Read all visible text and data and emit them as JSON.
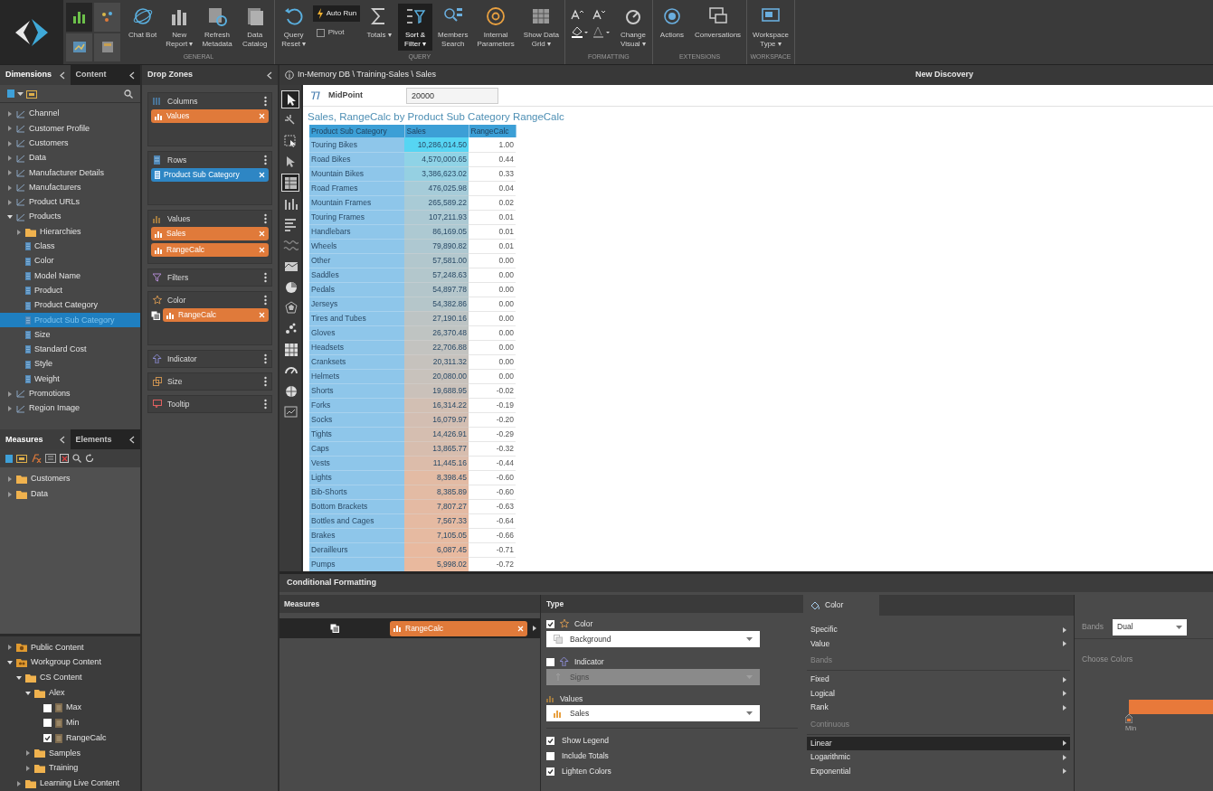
{
  "toolbar": {
    "groups": [
      {
        "label": "GENERAL",
        "buttons": [
          {
            "kind": "big",
            "lines": [
              "Chat Bot"
            ],
            "pressed": false
          },
          {
            "kind": "big",
            "lines": [
              "New",
              "Report ▾"
            ],
            "pressed": false
          },
          {
            "kind": "big",
            "lines": [
              "Refresh",
              "Metadata"
            ],
            "pressed": false
          },
          {
            "kind": "big",
            "lines": [
              "Data",
              "Catalog"
            ],
            "pressed": false
          }
        ]
      },
      {
        "label": "QUERY",
        "buttons": [
          {
            "kind": "big",
            "lines": [
              "Query",
              "Reset ▾"
            ],
            "pressed": false
          },
          {
            "kind": "stack",
            "lines": [
              "Auto Run",
              "Pivot"
            ],
            "pressed": true
          },
          {
            "kind": "big",
            "lines": [
              "Totals ▾"
            ],
            "pressed": false
          },
          {
            "kind": "big",
            "lines": [
              "Sort &",
              "Filter ▾"
            ],
            "pressed": true
          },
          {
            "kind": "big",
            "lines": [
              "Members",
              "Search"
            ],
            "pressed": false
          },
          {
            "kind": "big",
            "lines": [
              "Internal",
              "Parameters"
            ],
            "pressed": false
          },
          {
            "kind": "big",
            "lines": [
              "Show Data",
              "Grid ▾"
            ],
            "pressed": false
          }
        ]
      },
      {
        "label": "FORMATTING",
        "buttons": [
          {
            "kind": "fontgrid",
            "pressed": false
          },
          {
            "kind": "big",
            "lines": [
              "Change",
              "Visual ▾"
            ],
            "pressed": false
          }
        ]
      },
      {
        "label": "EXTENSIONS",
        "buttons": [
          {
            "kind": "big",
            "lines": [
              "Actions"
            ],
            "pressed": false
          },
          {
            "kind": "big",
            "lines": [
              "Conversations"
            ],
            "pressed": false
          }
        ]
      },
      {
        "label": "WORKSPACE",
        "buttons": [
          {
            "kind": "big",
            "lines": [
              "Workspace",
              "Type ▾"
            ],
            "pressed": false
          }
        ]
      }
    ]
  },
  "left_panel": {
    "tabs": [
      {
        "label": "Dimensions",
        "selected": true
      },
      {
        "label": "Content",
        "selected": false
      }
    ],
    "tree": [
      {
        "label": "Channel",
        "kind": "dimension",
        "expanded": false,
        "selected": false
      },
      {
        "label": "Customer Profile",
        "kind": "dimension",
        "expanded": false,
        "selected": false
      },
      {
        "label": "Customers",
        "kind": "dimension",
        "expanded": false,
        "selected": false
      },
      {
        "label": "Data",
        "kind": "dimension",
        "expanded": false,
        "selected": false
      },
      {
        "label": "Manufacturer Details",
        "kind": "dimension",
        "expanded": false,
        "selected": false
      },
      {
        "label": "Manufacturers",
        "kind": "dimension",
        "expanded": false,
        "selected": false
      },
      {
        "label": "Product URLs",
        "kind": "dimension",
        "expanded": false,
        "selected": false
      },
      {
        "label": "Products",
        "kind": "dimension",
        "expanded": true,
        "selected": false,
        "children": [
          {
            "label": "Hierarchies",
            "kind": "folder",
            "expanded": false,
            "selected": false
          },
          {
            "label": "Class",
            "kind": "attribute",
            "selected": false
          },
          {
            "label": "Color",
            "kind": "attribute",
            "selected": false
          },
          {
            "label": "Model Name",
            "kind": "attribute",
            "selected": false
          },
          {
            "label": "Product",
            "kind": "attribute",
            "selected": false
          },
          {
            "label": "Product Category",
            "kind": "attribute",
            "selected": false
          },
          {
            "label": "Product Sub Category",
            "kind": "attribute",
            "selected": true
          },
          {
            "label": "Size",
            "kind": "attribute",
            "selected": false
          },
          {
            "label": "Standard Cost",
            "kind": "attribute",
            "selected": false
          },
          {
            "label": "Style",
            "kind": "attribute",
            "selected": false
          },
          {
            "label": "Weight",
            "kind": "attribute",
            "selected": false
          }
        ]
      },
      {
        "label": "Promotions",
        "kind": "dimension",
        "expanded": false,
        "selected": false
      },
      {
        "label": "Region Image",
        "kind": "dimension",
        "expanded": false,
        "selected": false
      }
    ]
  },
  "measures_panel": {
    "tabs": [
      {
        "label": "Measures",
        "selected": true
      },
      {
        "label": "Elements",
        "selected": false
      }
    ],
    "tree": [
      {
        "label": "Customers",
        "kind": "folder",
        "expanded": false
      },
      {
        "label": "Data",
        "kind": "folder",
        "expanded": false
      }
    ]
  },
  "content_tree": [
    {
      "label": "Public Content",
      "kind": "public",
      "expanded": false
    },
    {
      "label": "Workgroup Content",
      "kind": "workgroup",
      "expanded": true,
      "children": [
        {
          "label": "CS Content",
          "kind": "folder",
          "expanded": true,
          "children": [
            {
              "label": "Alex",
              "kind": "folder",
              "expanded": true,
              "children": [
                {
                  "label": "Max",
                  "kind": "report",
                  "checked": false
                },
                {
                  "label": "Min",
                  "kind": "report",
                  "checked": false
                },
                {
                  "label": "RangeCalc",
                  "kind": "report",
                  "checked": true
                }
              ]
            },
            {
              "label": "Samples",
              "kind": "folder",
              "expanded": false
            },
            {
              "label": "Training",
              "kind": "folder",
              "expanded": false
            }
          ]
        },
        {
          "label": "Learning Live Content",
          "kind": "folder",
          "expanded": false
        }
      ]
    }
  ],
  "drop_zones": {
    "title": "Drop Zones",
    "zones": [
      {
        "label": "Columns",
        "kind": "columns",
        "expanded": true,
        "chips": [
          {
            "label": "Values",
            "color": "#e07a3a",
            "kind": "measure"
          }
        ]
      },
      {
        "label": "Rows",
        "kind": "rows",
        "expanded": true,
        "chips": [
          {
            "label": "Product Sub Category",
            "color": "#2e86c4",
            "kind": "hierarchy"
          }
        ]
      },
      {
        "label": "Values",
        "kind": "values",
        "expanded": true,
        "chips": [
          {
            "label": "Sales",
            "color": "#e07a3a",
            "kind": "measure"
          },
          {
            "label": "RangeCalc",
            "color": "#e07a3a",
            "kind": "measure"
          }
        ]
      },
      {
        "label": "Filters",
        "kind": "filters",
        "expanded": false
      },
      {
        "label": "Color",
        "kind": "color",
        "expanded": true,
        "chips": [
          {
            "label": "RangeCalc",
            "color": "#e07a3a",
            "kind": "formatted"
          }
        ]
      },
      {
        "label": "Indicator",
        "kind": "indicator",
        "expanded": false
      },
      {
        "label": "Size",
        "kind": "size",
        "expanded": false
      },
      {
        "label": "Tooltip",
        "kind": "tooltip",
        "expanded": false
      }
    ]
  },
  "main": {
    "breadcrumb": "In-Memory DB \\ Training-Sales \\ Sales",
    "title": "New Discovery",
    "tools": [
      {
        "selected": true
      },
      {
        "selected": false
      },
      {
        "selected": false
      },
      {
        "selected": false
      },
      {
        "selected": true
      },
      {
        "selected": false
      },
      {
        "selected": false
      },
      {
        "selected": false
      },
      {
        "selected": false
      },
      {
        "selected": false
      },
      {
        "selected": false
      },
      {
        "selected": false
      },
      {
        "selected": false
      },
      {
        "selected": false
      },
      {
        "selected": false
      },
      {
        "selected": false
      }
    ],
    "parameter": {
      "label": "MidPoint",
      "value": "20000"
    },
    "chart_title": "Sales, RangeCalc by Product Sub Category RangeCalc",
    "table": {
      "columns": [
        "Product Sub Category",
        "Sales",
        "RangeCalc"
      ],
      "rows": [
        {
          "cells": [
            "Touring Bikes",
            "10,286,014.50",
            "1.00"
          ],
          "color": "#56d5f3"
        },
        {
          "cells": [
            "Road Bikes",
            "4,570,000.65",
            "0.44"
          ],
          "color": "#8fd3e6"
        },
        {
          "cells": [
            "Mountain Bikes",
            "3,386,623.02",
            "0.33"
          ],
          "color": "#95d0e2"
        },
        {
          "cells": [
            "Road Frames",
            "476,025.98",
            "0.04"
          ],
          "color": "#a6ccd9"
        },
        {
          "cells": [
            "Mountain Frames",
            "265,589.22",
            "0.02"
          ],
          "color": "#a9cbd6"
        },
        {
          "cells": [
            "Touring Frames",
            "107,211.93",
            "0.01"
          ],
          "color": "#acc9d3"
        },
        {
          "cells": [
            "Handlebars",
            "86,169.05",
            "0.01"
          ],
          "color": "#adc9d2"
        },
        {
          "cells": [
            "Wheels",
            "79,890.82",
            "0.01"
          ],
          "color": "#aec8d1"
        },
        {
          "cells": [
            "Other",
            "57,581.00",
            "0.00"
          ],
          "color": "#b2c7cd"
        },
        {
          "cells": [
            "Saddles",
            "57,248.63",
            "0.00"
          ],
          "color": "#b3c7cc"
        },
        {
          "cells": [
            "Pedals",
            "54,897.78",
            "0.00"
          ],
          "color": "#b4c6cb"
        },
        {
          "cells": [
            "Jerseys",
            "54,382.86",
            "0.00"
          ],
          "color": "#b5c6ca"
        },
        {
          "cells": [
            "Tires and Tubes",
            "27,190.16",
            "0.00"
          ],
          "color": "#bdc4c4"
        },
        {
          "cells": [
            "Gloves",
            "26,370.48",
            "0.00"
          ],
          "color": "#bfc4c2"
        },
        {
          "cells": [
            "Headsets",
            "22,706.88",
            "0.00"
          ],
          "color": "#c3c3c0"
        },
        {
          "cells": [
            "Cranksets",
            "20,311.32",
            "0.00"
          ],
          "color": "#c6c2bd"
        },
        {
          "cells": [
            "Helmets",
            "20,080.00",
            "0.00"
          ],
          "color": "#c8c2bc"
        },
        {
          "cells": [
            "Shorts",
            "19,688.95",
            "-0.02"
          ],
          "color": "#cac1ba"
        },
        {
          "cells": [
            "Forks",
            "16,314.22",
            "-0.19"
          ],
          "color": "#d2bfb3"
        },
        {
          "cells": [
            "Socks",
            "16,079.97",
            "-0.20"
          ],
          "color": "#d3beb2"
        },
        {
          "cells": [
            "Tights",
            "14,426.91",
            "-0.29"
          ],
          "color": "#d5beb0"
        },
        {
          "cells": [
            "Caps",
            "13,865.77",
            "-0.32"
          ],
          "color": "#d7bdae"
        },
        {
          "cells": [
            "Vests",
            "11,445.16",
            "-0.44"
          ],
          "color": "#dcbcaa"
        },
        {
          "cells": [
            "Lights",
            "8,398.45",
            "-0.60"
          ],
          "color": "#e3bba4"
        },
        {
          "cells": [
            "Bib-Shorts",
            "8,385.89",
            "-0.60"
          ],
          "color": "#e3bba4"
        },
        {
          "cells": [
            "Bottom Brackets",
            "7,807.27",
            "-0.63"
          ],
          "color": "#e4baa3"
        },
        {
          "cells": [
            "Bottles and Cages",
            "7,567.33",
            "-0.64"
          ],
          "color": "#e5baa2"
        },
        {
          "cells": [
            "Brakes",
            "7,105.05",
            "-0.66"
          ],
          "color": "#e6baa1"
        },
        {
          "cells": [
            "Derailleurs",
            "6,087.45",
            "-0.71"
          ],
          "color": "#e8b99f"
        },
        {
          "cells": [
            "Pumps",
            "5,998.02",
            "-0.72"
          ],
          "color": "#e9b99e"
        }
      ]
    }
  },
  "conditional_formatting": {
    "title": "Conditional Formatting",
    "measures": {
      "header": "Measures",
      "items": [
        {
          "label": "RangeCalc",
          "selected": true
        }
      ]
    },
    "type": {
      "header": "Type",
      "options": [
        {
          "label": "Color",
          "kind": "color",
          "checked": true,
          "dropdown": "Background",
          "disabled": false
        },
        {
          "label": "Indicator",
          "kind": "indicator",
          "checked": false,
          "dropdown": "Signs",
          "disabled": true
        }
      ],
      "values_label": "Values",
      "values_dropdown": "Sales",
      "checkboxes": [
        {
          "label": "Show Legend",
          "checked": true
        },
        {
          "label": "Include Totals",
          "checked": false
        },
        {
          "label": "Lighten Colors",
          "checked": true
        }
      ]
    },
    "color_tab": {
      "label": "Color",
      "items": [
        {
          "label": "Specific",
          "kind": "item",
          "selected": false
        },
        {
          "label": "Value",
          "kind": "item",
          "selected": false
        },
        {
          "label": "Bands",
          "kind": "heading"
        },
        {
          "label": "Fixed",
          "kind": "item",
          "selected": false
        },
        {
          "label": "Logical",
          "kind": "item",
          "selected": false
        },
        {
          "label": "Rank",
          "kind": "item",
          "selected": false
        },
        {
          "label": "Continuous",
          "kind": "heading"
        },
        {
          "label": "Linear",
          "kind": "item",
          "selected": true
        },
        {
          "label": "Logarithmic",
          "kind": "item",
          "selected": false
        },
        {
          "label": "Exponential",
          "kind": "item",
          "selected": false
        }
      ]
    },
    "bands": {
      "label": "Bands",
      "value": "Dual",
      "choose_label": "Choose Colors",
      "min_label": "Min"
    }
  }
}
